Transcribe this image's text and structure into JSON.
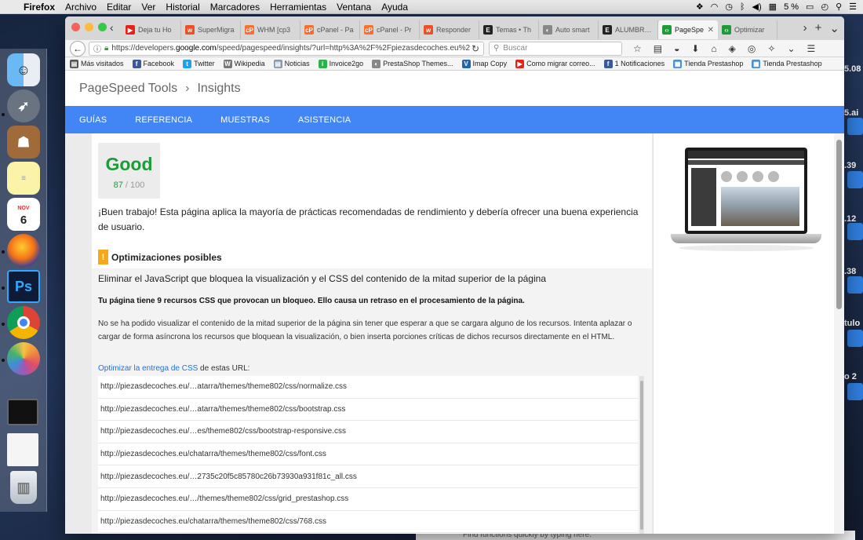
{
  "menubar": {
    "app": "Firefox",
    "items": [
      "Archivo",
      "Editar",
      "Ver",
      "Historial",
      "Marcadores",
      "Herramientas",
      "Ventana",
      "Ayuda"
    ],
    "battery": "5 %"
  },
  "tabs": [
    {
      "title": "Deja tu Ho",
      "color": "#e62117",
      "glyph": "▶"
    },
    {
      "title": "SuperMigra",
      "color": "#f04e23",
      "glyph": "w"
    },
    {
      "title": "WHM [cp3",
      "color": "#ff6c2c",
      "glyph": "cP"
    },
    {
      "title": "cPanel - Pa",
      "color": "#ff6c2c",
      "glyph": "cP"
    },
    {
      "title": "cPanel - Pr",
      "color": "#ff6c2c",
      "glyph": "cP"
    },
    {
      "title": "Responder",
      "color": "#f04e23",
      "glyph": "w"
    },
    {
      "title": "Temas • Th",
      "color": "#222222",
      "glyph": "E"
    },
    {
      "title": "Auto smart",
      "color": "#888888",
      "glyph": "◐"
    },
    {
      "title": "ALUMBRAD",
      "color": "#222222",
      "glyph": "E"
    },
    {
      "title": "PageSpe",
      "color": "#1e9b38",
      "glyph": "‹›",
      "active": true
    },
    {
      "title": "Optimizar",
      "color": "#1e9b38",
      "glyph": "‹›"
    }
  ],
  "url": {
    "prefix": "https://developers.",
    "domain": "google.com",
    "rest": "/speed/pagespeed/insights/?url=http%3A%2F%2Fpiezasdecoches.eu%2"
  },
  "search": {
    "placeholder": "Buscar"
  },
  "bookmarks": [
    {
      "label": "Más visitados",
      "color": "#555555",
      "glyph": "▤"
    },
    {
      "label": "Facebook",
      "color": "#3b5998",
      "glyph": "f"
    },
    {
      "label": "Twitter",
      "color": "#1da1f2",
      "glyph": "t"
    },
    {
      "label": "Wikipedia",
      "color": "#777777",
      "glyph": "W"
    },
    {
      "label": "Noticias",
      "color": "#8a9bb0",
      "glyph": "▤"
    },
    {
      "label": "Invoice2go",
      "color": "#2db14a",
      "glyph": "i"
    },
    {
      "label": "PrestaShop Themes...",
      "color": "#888888",
      "glyph": "◐"
    },
    {
      "label": "Imap Copy",
      "color": "#2266aa",
      "glyph": "V"
    },
    {
      "label": "Como migrar correo...",
      "color": "#e62117",
      "glyph": "▶"
    },
    {
      "label": "1 Notificaciones",
      "color": "#3b5998",
      "glyph": "f"
    },
    {
      "label": "Tienda Prestashop",
      "color": "#4a90d9",
      "glyph": "▦"
    },
    {
      "label": "Tienda Prestashop",
      "color": "#4a90d9",
      "glyph": "▦"
    }
  ],
  "header": {
    "tools": "PageSpeed Tools",
    "separator": "›",
    "section": "Insights"
  },
  "nav": [
    "GUÍAS",
    "REFERENCIA",
    "MUESTRAS",
    "ASISTENCIA"
  ],
  "score": {
    "label": "Good",
    "value": "87",
    "max": "/ 100"
  },
  "summary": "¡Buen trabajo! Esta página aplica la mayoría de prácticas recomendadas de rendimiento y debería ofrecer una buena experiencia de usuario.",
  "optimizations_heading": "Optimizaciones posibles",
  "rule": {
    "title": "Eliminar el JavaScript que bloquea la visualización y el CSS del contenido de la mitad superior de la página",
    "bold": "Tu página tiene 9 recursos CSS que provocan un bloqueo. Ello causa un retraso en el procesamiento de la página.",
    "description": "No se ha podido visualizar el contenido de la mitad superior de la página sin tener que esperar a que se cargara alguno de los recursos. Intenta aplazar o cargar de forma asíncrona los recursos que bloquean la visualización, o bien inserta porciones críticas de dichos recursos directamente en el HTML.",
    "link_text": "Optimizar la entrega de CSS",
    "link_suffix": " de estas URL:",
    "urls": [
      "http://piezasdecoches.eu/…atarra/themes/theme802/css/normalize.css",
      "http://piezasdecoches.eu/…atarra/themes/theme802/css/bootstrap.css",
      "http://piezasdecoches.eu/…es/theme802/css/bootstrap-responsive.css",
      "http://piezasdecoches.eu/chatarra/themes/theme802/css/font.css",
      "http://piezasdecoches.eu/…2735c20f5c85780c26b73930a931f81c_all.css",
      "http://piezasdecoches.eu/…/themes/theme802/css/grid_prestashop.css",
      "http://piezasdecoches.eu/chatarra/themes/theme802/css/768.css"
    ]
  },
  "dock_calendar": {
    "month": "NOV",
    "day": "6"
  },
  "peek_labels": [
    "5.08",
    "5.ai",
    ".39",
    ".12",
    ".38",
    "tulo",
    "o 2"
  ],
  "bottom_hint": "Find functions quickly by typing here.",
  "colors": {
    "good": "#1e9b38",
    "brand_blue": "#4285f4",
    "warning": "#f7a71a",
    "link": "#1a73e8"
  }
}
